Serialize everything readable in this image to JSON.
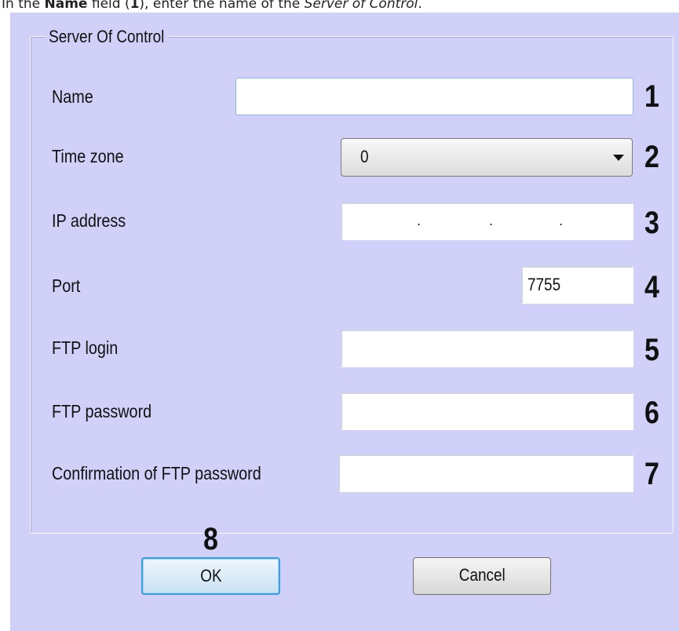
{
  "caption": {
    "prefix": "In the ",
    "field": "Name",
    "middle": " field (",
    "number": "1",
    "suffix": "), enter the name of the ",
    "object": "Server of Control",
    "end": "."
  },
  "dialog": {
    "group_title": "Server Of Control",
    "fields": {
      "name": {
        "label": "Name",
        "value": "",
        "marker": "1"
      },
      "time_zone": {
        "label": "Time zone",
        "value": "0",
        "marker": "2"
      },
      "ip_address": {
        "label": "IP address",
        "value": ". . .",
        "marker": "3"
      },
      "port": {
        "label": "Port",
        "value": "7755",
        "marker": "4"
      },
      "ftp_login": {
        "label": "FTP login",
        "value": "",
        "marker": "5"
      },
      "ftp_password": {
        "label": "FTP password",
        "value": "",
        "marker": "6"
      },
      "ftp_password_confirm": {
        "label": "Confirmation of FTP password",
        "value": "",
        "marker": "7"
      }
    },
    "ok_marker": "8",
    "ok_label": "OK",
    "cancel_label": "Cancel"
  },
  "colors": {
    "dialog_background": "#d0d0f8",
    "focus_border": "#3c9ee0"
  },
  "icons": {
    "combo_arrow": "chevron-down-icon"
  }
}
